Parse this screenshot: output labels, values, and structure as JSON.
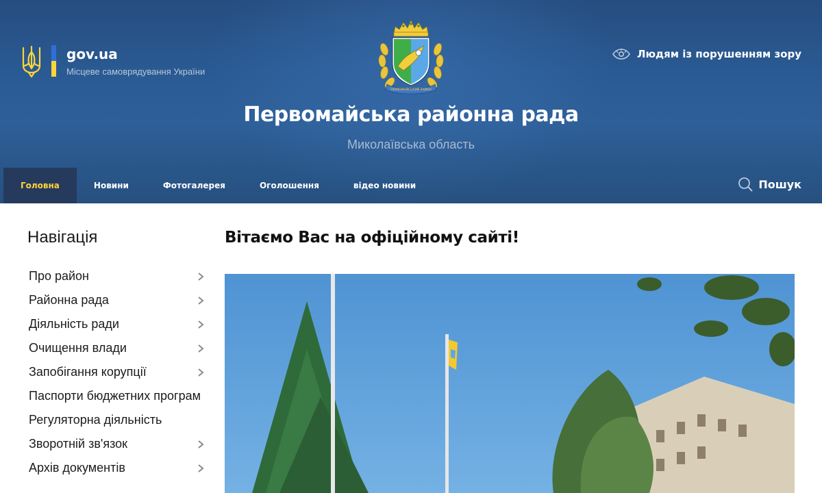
{
  "header": {
    "govua_title": "gov.ua",
    "govua_subtitle": "Місцеве самоврядування України",
    "org_title": "Первомайська районна рада",
    "org_subtitle": "Миколаївська область",
    "accessibility_label": "Людям із порушенням зору",
    "emblem_icon": "district-coat-of-arms",
    "emblem_ribbon_text": "ПЕРВОМАЙСЬКИЙ РАЙОН",
    "colors": {
      "header_bg": "#2a5a93",
      "accent_yellow": "#ffd43a",
      "accent_blue": "#2f6fd6",
      "nav_active_bg": "#253a5c"
    }
  },
  "nav": {
    "items": [
      {
        "label": "Головна",
        "active": true
      },
      {
        "label": "Новини",
        "active": false
      },
      {
        "label": "Фотогалерея",
        "active": false
      },
      {
        "label": "Оголошення",
        "active": false
      },
      {
        "label": "відео новини",
        "active": false
      }
    ],
    "search_label": "Пошук"
  },
  "sidebar": {
    "title": "Навігація",
    "items": [
      {
        "label": "Про район",
        "has_submenu": true
      },
      {
        "label": "Районна рада",
        "has_submenu": true
      },
      {
        "label": "Діяльність ради",
        "has_submenu": true
      },
      {
        "label": "Очищення влади",
        "has_submenu": true
      },
      {
        "label": "Запобігання корупції",
        "has_submenu": true
      },
      {
        "label": "Паспорти бюджетних програм",
        "has_submenu": false
      },
      {
        "label": "Регуляторна діяльність",
        "has_submenu": false
      },
      {
        "label": "Зворотній зв'язок",
        "has_submenu": true
      },
      {
        "label": "Архів документів",
        "has_submenu": true
      }
    ]
  },
  "main": {
    "title": "Вітаємо Вас на офіційному сайті!",
    "photo_icon": "building-with-flagpoles-photo"
  }
}
